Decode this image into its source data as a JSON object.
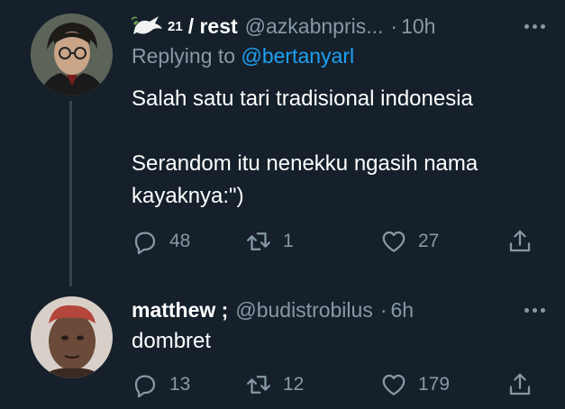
{
  "tweets": [
    {
      "display_name": "/ rest",
      "badge": "21",
      "handle": "@azkabnpris...",
      "separator": "·",
      "time": "10h",
      "replying_prefix": "Replying to",
      "replying_to": "@bertanyarl",
      "text": "Salah satu tari tradisional indonesia\n\nSerandom itu nenekku ngasih nama kayaknya:\")",
      "replies": "48",
      "retweets": "1",
      "likes": "27"
    },
    {
      "display_name": "matthew ;",
      "handle": "@budistrobilus",
      "separator": "·",
      "time": "6h",
      "text": "dombret",
      "replies": "13",
      "retweets": "12",
      "likes": "179"
    }
  ],
  "colors": {
    "background": "#15202b",
    "secondary_text": "#8899a6",
    "accent": "#1da1f2",
    "thread_line": "#38444d"
  },
  "icons": {
    "reply": "reply-icon",
    "retweet": "retweet-icon",
    "like": "heart-icon",
    "share": "share-icon",
    "more": "more-icon",
    "dove": "dove-icon"
  }
}
